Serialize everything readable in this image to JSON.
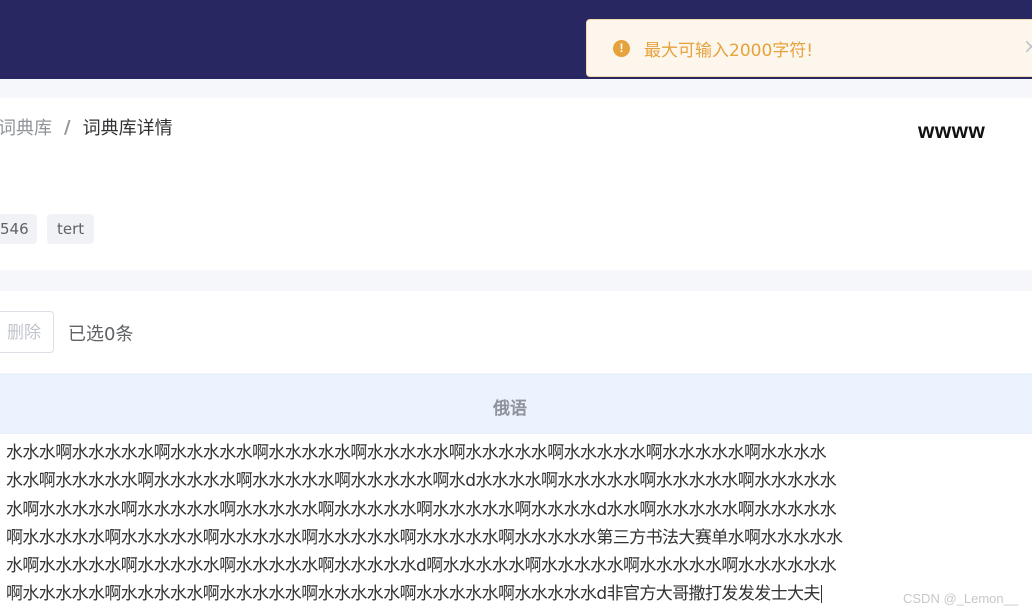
{
  "toast": {
    "icon": "warning-circle-icon",
    "icon_glyph": "!",
    "message": "最大可输入2000字符!",
    "close_glyph": "×",
    "color": "#e6a23c"
  },
  "breadcrumb": {
    "items": [
      "词典库",
      "词典库详情"
    ],
    "separator": "/"
  },
  "header": {
    "title": "wwww",
    "tags": [
      "546",
      "tert"
    ]
  },
  "toolbar": {
    "delete_label": "删除",
    "selected_text": "已选0条"
  },
  "table": {
    "column_header": "俄语",
    "cell_lines": [
      "水水水啊水水水水水啊水水水水水啊水水水水水啊水水水水水啊水水水水水啊水水水水水啊水水水水水啊水水水水",
      "水水啊水水水水水啊水水水水水啊水水水水水啊水水水水水啊水d水水水水啊水水水水水啊水水水水水啊水水水水水",
      "水啊水水水水水啊水水水水水啊水水水水水啊水水水水水啊水水水水水啊水水水水d水水啊水水水水水啊水水水水水",
      "啊水水水水水啊水水水水水啊水水水水水啊水水水水水啊水水水水水啊水水水水水第三方书法大赛单水啊水水水水水",
      "水啊水水水水水啊水水水水水啊水水水水水啊水水水水水d啊水水水水水啊水水水水水啊水水水水水啊水水水水水水",
      "啊水水水水水啊水水水水水啊水水水水水啊水水水水水啊水水水水水啊水水水水水d非官方大哥撒打发发发士大夫"
    ]
  },
  "watermark": "CSDN @_Lemon__",
  "colors": {
    "topbar": "#292762",
    "accent_warning": "#e6a23c",
    "table_header_bg": "#eaf3fe"
  }
}
